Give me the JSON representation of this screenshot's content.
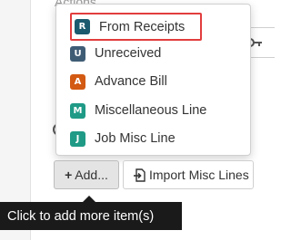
{
  "background": {
    "section_label": "Actions"
  },
  "menu": {
    "items": [
      {
        "badge": "R",
        "label": "From Receipts",
        "color": "#1b5a6e",
        "selected": true
      },
      {
        "badge": "U",
        "label": "Unreceived",
        "color": "#3f5c75",
        "selected": false
      },
      {
        "badge": "A",
        "label": "Advance Bill",
        "color": "#d35a12",
        "selected": false
      },
      {
        "badge": "M",
        "label": "Miscellaneous Line",
        "color": "#1f9a86",
        "selected": false
      },
      {
        "badge": "J",
        "label": "Job Misc Line",
        "color": "#1f9a86",
        "selected": false
      }
    ]
  },
  "toolbar": {
    "add_plus": "+",
    "add_label": "Add...",
    "import_label": "Import Misc Lines",
    "import_icon": "import-file-icon"
  },
  "tooltip": {
    "text": "Click to add more item(s)"
  },
  "colors": {
    "highlight_border": "#e23d3d",
    "tooltip_bg": "#1a1a1a"
  }
}
